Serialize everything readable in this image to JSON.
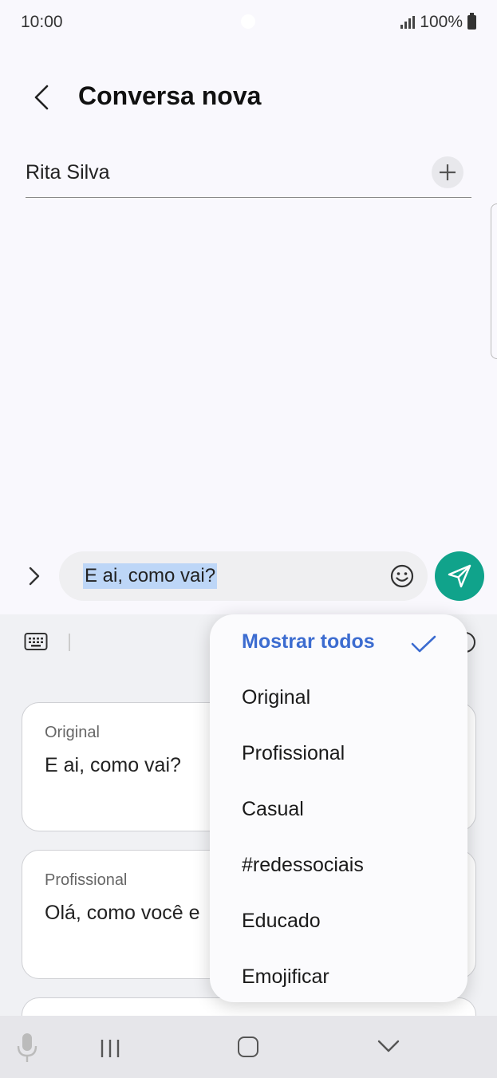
{
  "status": {
    "time": "10:00",
    "battery": "100%"
  },
  "header": {
    "title": "Conversa nova"
  },
  "recipient": {
    "name": "Rita Silva"
  },
  "compose": {
    "message": "E ai, como vai?"
  },
  "suggestions": [
    {
      "label": "Original",
      "text": "E ai, como vai?"
    },
    {
      "label": "Profissional",
      "text": "Olá, como você e"
    }
  ],
  "dropdown": {
    "options": [
      "Mostrar todos",
      "Original",
      "Profissional",
      "Casual",
      "#redessociais",
      "Educado",
      "Emojificar"
    ],
    "selected": "Mostrar todos"
  },
  "colors": {
    "accent": "#3c6cd0",
    "send": "#10a38b",
    "selection": "#bdd6f7"
  },
  "icons": [
    "back-arrow-icon",
    "plus-icon",
    "chevron-right-icon",
    "smiley-icon",
    "send-icon",
    "keyboard-icon",
    "check-icon",
    "mic-icon",
    "recent-apps-icon",
    "home-icon",
    "chevron-down-icon"
  ]
}
